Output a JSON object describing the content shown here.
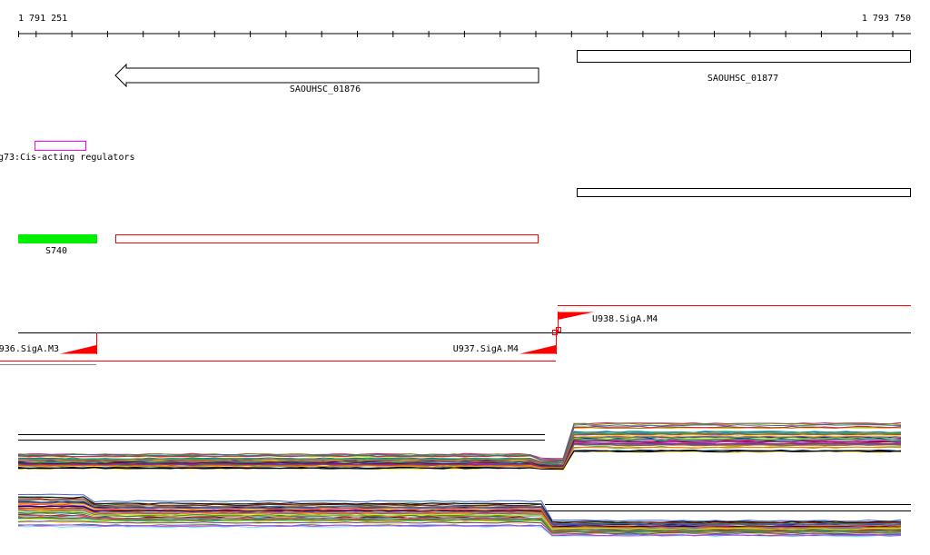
{
  "ruler": {
    "start_label": "1 791 251",
    "end_label": "1 793 750",
    "tick_count": 26
  },
  "genes": [
    {
      "name": "SAOUHSC_01876",
      "strand": "-"
    },
    {
      "name": "SAOUHSC_01877",
      "strand": "+"
    }
  ],
  "regulator": {
    "label": "g73:Cis-acting regulators",
    "color": "#ff00ff"
  },
  "features": {
    "s740_label": "S740",
    "s740_color": "#00ee00",
    "outline_color": "#ff0000"
  },
  "promoters": [
    {
      "label": "936.SigA.M3"
    },
    {
      "label": "U937.SigA.M4"
    },
    {
      "label": "U938.SigA.M4"
    }
  ],
  "colors": {
    "promoter": "#ff0000",
    "track_line": "#000000"
  },
  "expression_palette": [
    "#e6194b",
    "#3cb44b",
    "#ffe119",
    "#4363d8",
    "#f58231",
    "#911eb4",
    "#46f0f0",
    "#f032e6",
    "#bcf60c",
    "#008080",
    "#9a6324",
    "#800000",
    "#808000",
    "#000075",
    "#808080",
    "#000000",
    "#ff7f00",
    "#6a3d9a",
    "#b15928",
    "#1f78b4"
  ]
}
